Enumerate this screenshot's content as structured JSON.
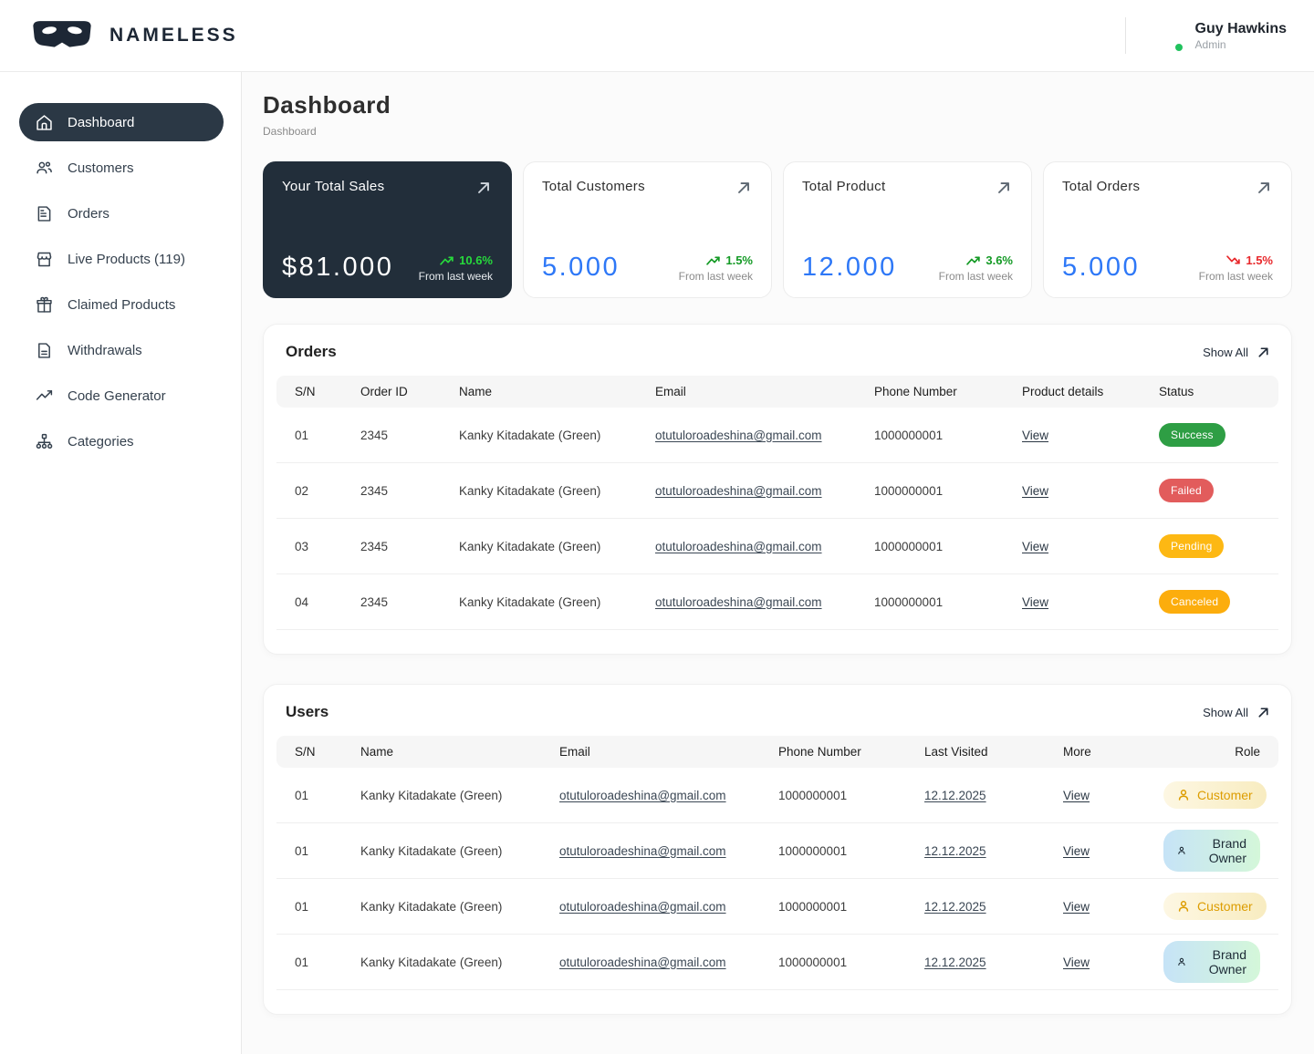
{
  "header": {
    "brand": "NAMELESS",
    "user": {
      "name": "Guy Hawkins",
      "role": "Admin"
    }
  },
  "sidebar": {
    "items": [
      {
        "label": "Dashboard",
        "active": true
      },
      {
        "label": "Customers"
      },
      {
        "label": "Orders"
      },
      {
        "label": "Live Products (119)"
      },
      {
        "label": "Claimed Products"
      },
      {
        "label": "Withdrawals"
      },
      {
        "label": "Code Generator"
      },
      {
        "label": "Categories"
      }
    ]
  },
  "page": {
    "title": "Dashboard",
    "breadcrumb": "Dashboard"
  },
  "stats": {
    "cards": [
      {
        "title": "Your Total Sales",
        "value": "$81.000",
        "trend": "10.6%",
        "direction": "up",
        "note": "From last week"
      },
      {
        "title": "Total Customers",
        "value": "5.000",
        "trend": "1.5%",
        "direction": "up",
        "note": "From last week"
      },
      {
        "title": "Total Product",
        "value": "12.000",
        "trend": "3.6%",
        "direction": "up",
        "note": "From last week"
      },
      {
        "title": "Total Orders",
        "value": "5.000",
        "trend": "1.5%",
        "direction": "down",
        "note": "From last week"
      }
    ]
  },
  "orders": {
    "title": "Orders",
    "show_all_label": "Show All",
    "columns": {
      "sn": "S/N",
      "order_id": "Order ID",
      "name": "Name",
      "email": "Email",
      "phone": "Phone Number",
      "details": "Product details",
      "status": "Status"
    },
    "rows": [
      {
        "sn": "01",
        "order_id": "2345",
        "name": "Kanky Kitadakate (Green)",
        "email": "otutuloroadeshina@gmail.com",
        "phone": "1000000001",
        "details": "View",
        "status": "Success"
      },
      {
        "sn": "02",
        "order_id": "2345",
        "name": "Kanky Kitadakate (Green)",
        "email": "otutuloroadeshina@gmail.com",
        "phone": "1000000001",
        "details": "View",
        "status": "Failed"
      },
      {
        "sn": "03",
        "order_id": "2345",
        "name": "Kanky Kitadakate (Green)",
        "email": "otutuloroadeshina@gmail.com",
        "phone": "1000000001",
        "details": "View",
        "status": "Pending"
      },
      {
        "sn": "04",
        "order_id": "2345",
        "name": "Kanky Kitadakate (Green)",
        "email": "otutuloroadeshina@gmail.com",
        "phone": "1000000001",
        "details": "View",
        "status": "Canceled"
      }
    ]
  },
  "users": {
    "title": "Users",
    "show_all_label": "Show All",
    "columns": {
      "sn": "S/N",
      "name": "Name",
      "email": "Email",
      "phone": "Phone Number",
      "last_visited": "Last Visited",
      "more": "More",
      "role": "Role"
    },
    "rows": [
      {
        "sn": "01",
        "name": "Kanky Kitadakate (Green)",
        "email": "otutuloroadeshina@gmail.com",
        "phone": "1000000001",
        "last_visited": "12.12.2025",
        "more": "View",
        "role": "Customer"
      },
      {
        "sn": "01",
        "name": "Kanky Kitadakate (Green)",
        "email": "otutuloroadeshina@gmail.com",
        "phone": "1000000001",
        "last_visited": "12.12.2025",
        "more": "View",
        "role": "Brand Owner"
      },
      {
        "sn": "01",
        "name": "Kanky Kitadakate (Green)",
        "email": "otutuloroadeshina@gmail.com",
        "phone": "1000000001",
        "last_visited": "12.12.2025",
        "more": "View",
        "role": "Customer"
      },
      {
        "sn": "01",
        "name": "Kanky Kitadakate (Green)",
        "email": "otutuloroadeshina@gmail.com",
        "phone": "1000000001",
        "last_visited": "12.12.2025",
        "more": "View",
        "role": "Brand Owner"
      }
    ]
  },
  "colors": {
    "accent_blue": "#2E78F7",
    "positive_green": "#149A25",
    "positive_green_bright": "#27D93C",
    "negative_red": "#E8282B",
    "dark_card_bg": "#222E3A",
    "sidebar_active_bg": "#2B3845",
    "status_success": "#2E9E44",
    "status_failed": "#E25C5C",
    "status_pending": "#FDB813",
    "status_canceled": "#FCAD0D",
    "role_customer_text": "#DD9D02",
    "online_dot": "#21C25E"
  }
}
